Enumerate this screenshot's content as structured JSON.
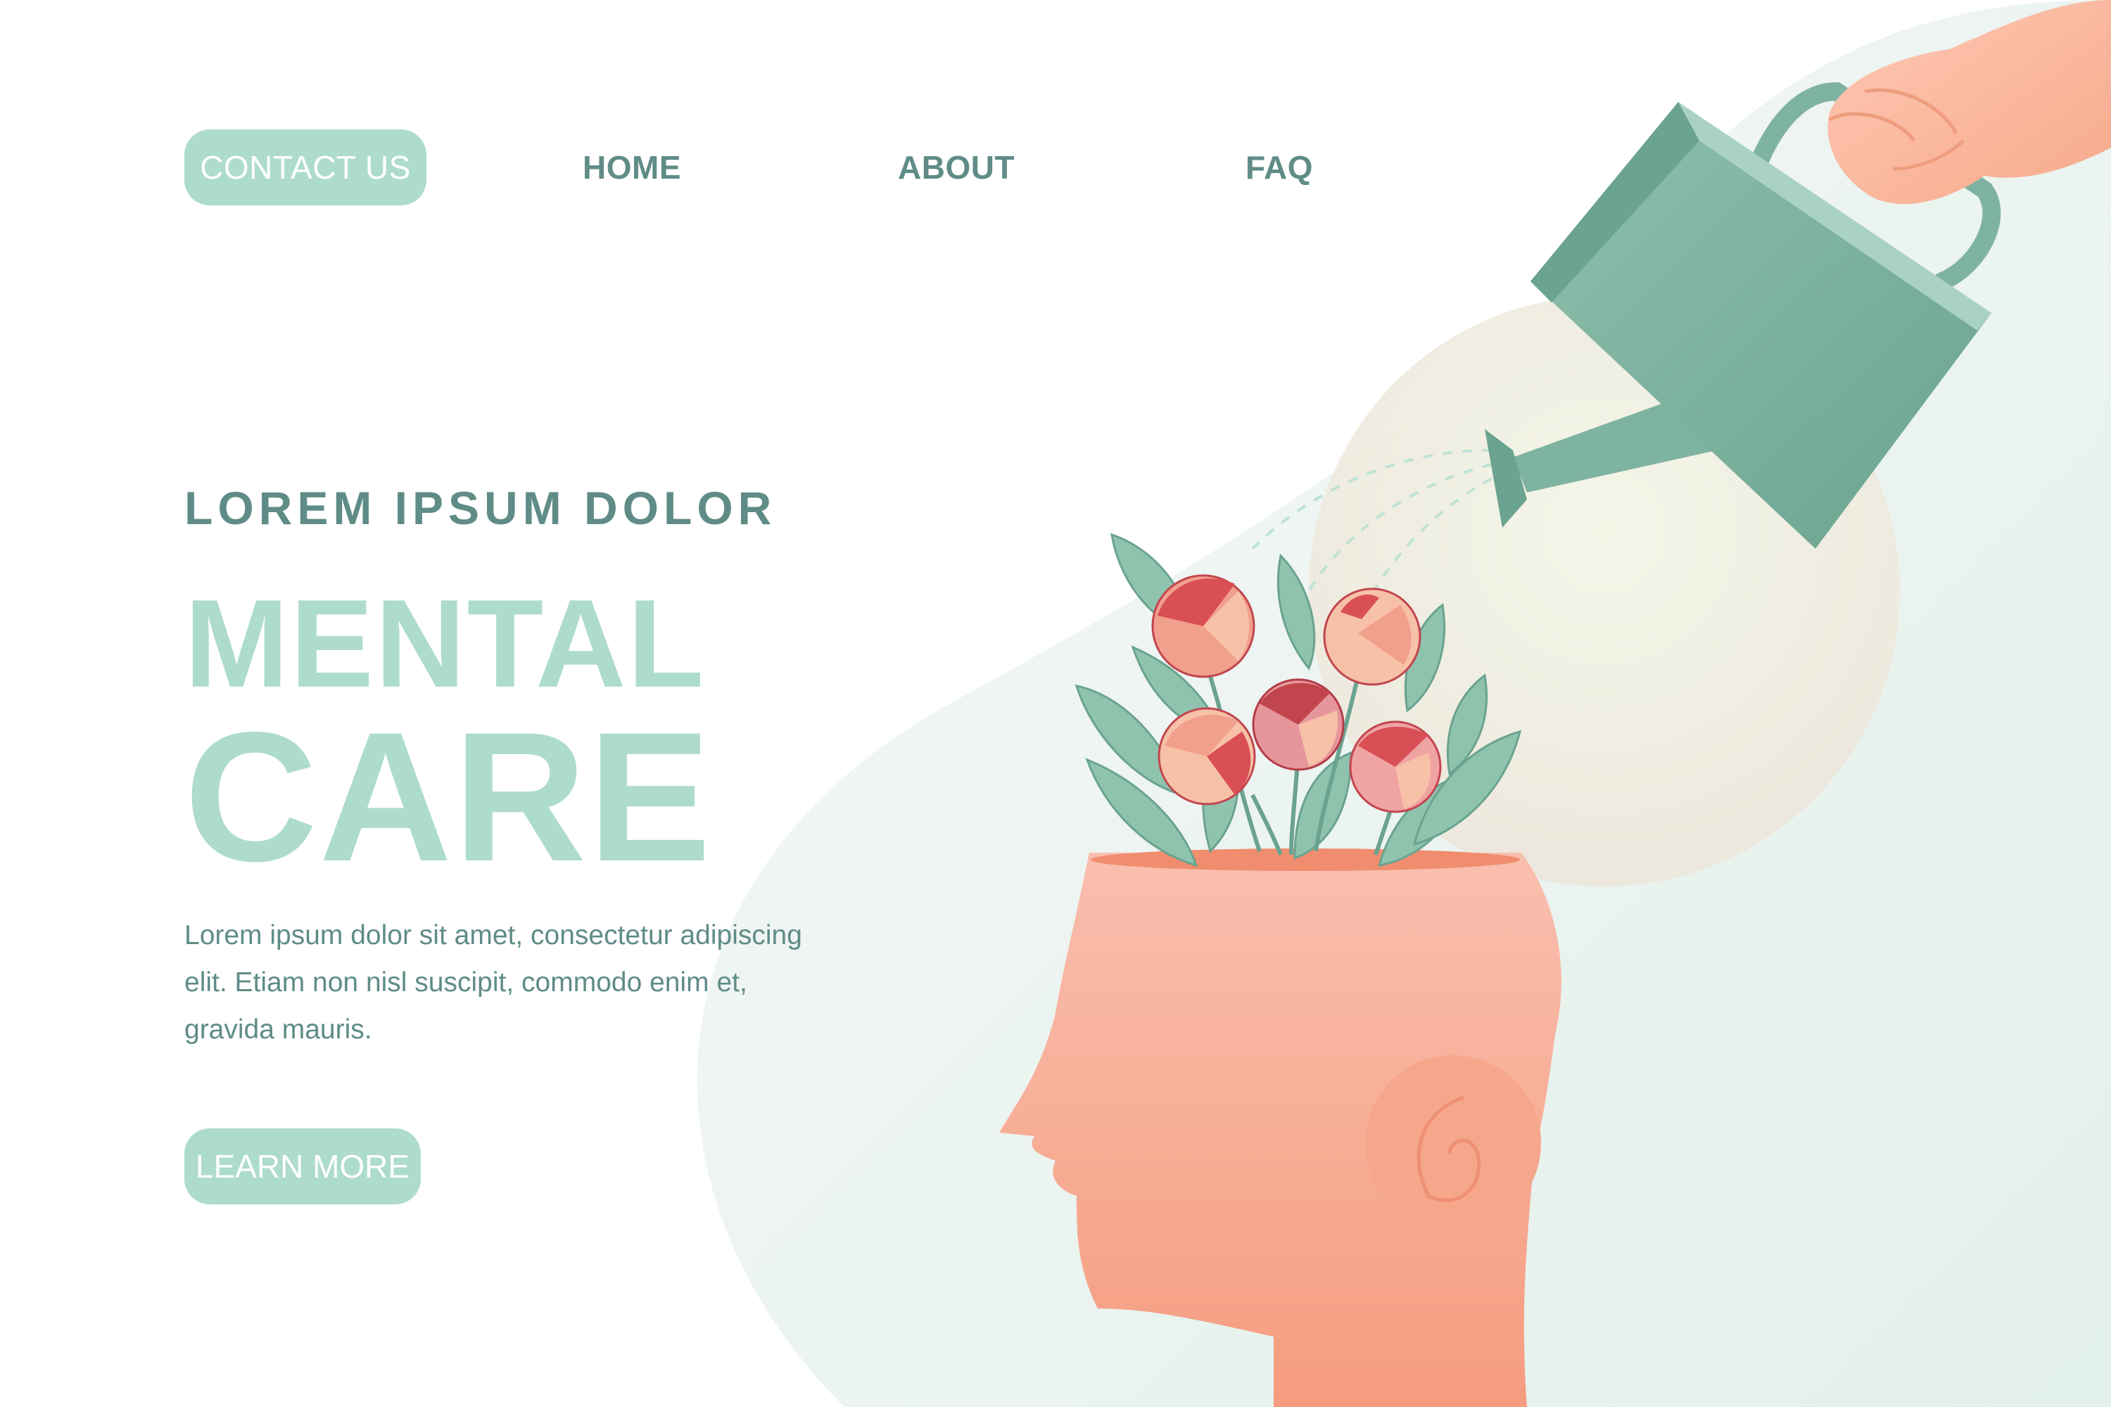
{
  "nav": {
    "contact_label": "CONTACT US",
    "home_label": "HOME",
    "about_label": "ABOUT",
    "faq_label": "FAQ"
  },
  "hero": {
    "kicker": "LOREM IPSUM DOLOR",
    "title_line1": "MENTAL",
    "title_line2": "CARE",
    "description": "Lorem ipsum dolor sit amet, consectetur adipiscing elit. Etiam non nisl suscipit, commodo enim et, gravida mauris.",
    "cta_label": "LEARN MORE"
  },
  "colors": {
    "accent_mint": "#aedcca",
    "text_teal": "#5f8c87",
    "skin": "#f7b7a0",
    "watering_can": "#7fb3a1",
    "flower_red": "#d94f56"
  },
  "icons": {
    "illustration": "head-with-flowers-watering-can"
  }
}
